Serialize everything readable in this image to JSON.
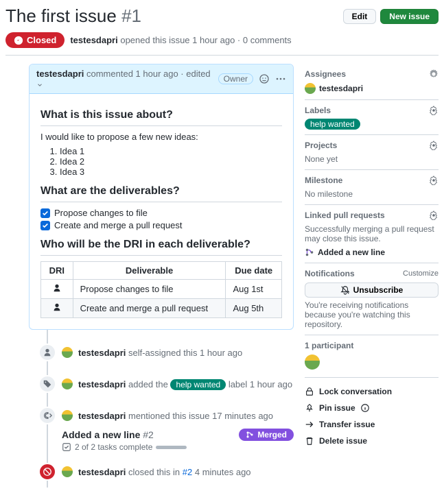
{
  "header": {
    "title": "The first issue",
    "number": "#1",
    "edit": "Edit",
    "new_issue": "New issue"
  },
  "status": {
    "state": "Closed",
    "author": "testesdapri",
    "opened": "opened this issue 1 hour ago · 0 comments"
  },
  "comment": {
    "author": "testesdapri",
    "meta": "commented 1 hour ago · edited",
    "owner": "Owner",
    "h1": "What is this issue about?",
    "intro": "I would like to propose a few new ideas:",
    "ideas": [
      "Idea 1",
      "Idea 2",
      "Idea 3"
    ],
    "h2": "What are the deliverables?",
    "tasks": [
      "Propose changes to file",
      "Create and merge a pull request"
    ],
    "h3": "Who will be the DRI in each deliverable?",
    "table": {
      "cols": [
        "DRI",
        "Deliverable",
        "Due date"
      ],
      "rows": [
        [
          "",
          "Propose changes to file",
          "Aug 1st"
        ],
        [
          "",
          "Create and merge a pull request",
          "Aug 5th"
        ]
      ]
    }
  },
  "timeline": {
    "self_assign": {
      "user": "testesdapri",
      "text": "self-assigned this 1 hour ago"
    },
    "label": {
      "user": "testesdapri",
      "pre": "added the",
      "label": "help wanted",
      "post": "label 1 hour ago"
    },
    "mention": {
      "user": "testesdapri",
      "text": "mentioned this issue 17 minutes ago"
    },
    "ref": {
      "title": "Added a new line",
      "num": "#2",
      "merged": "Merged",
      "tasks": "2 of 2 tasks complete"
    },
    "closed": {
      "user": "testesdapri",
      "pre": "closed this in",
      "ref": "#2",
      "time": "4 minutes ago"
    }
  },
  "side": {
    "assignees": {
      "title": "Assignees",
      "user": "testesdapri"
    },
    "labels": {
      "title": "Labels",
      "label": "help wanted"
    },
    "projects": {
      "title": "Projects",
      "value": "None yet"
    },
    "milestone": {
      "title": "Milestone",
      "value": "No milestone"
    },
    "linked": {
      "title": "Linked pull requests",
      "desc": "Successfully merging a pull request may close this issue.",
      "item": "Added a new line"
    },
    "notif": {
      "title": "Notifications",
      "customize": "Customize",
      "btn": "Unsubscribe",
      "desc": "You're receiving notifications because you're watching this repository."
    },
    "participants": "1 participant",
    "actions": {
      "lock": "Lock conversation",
      "pin": "Pin issue",
      "transfer": "Transfer issue",
      "delete": "Delete issue"
    }
  }
}
